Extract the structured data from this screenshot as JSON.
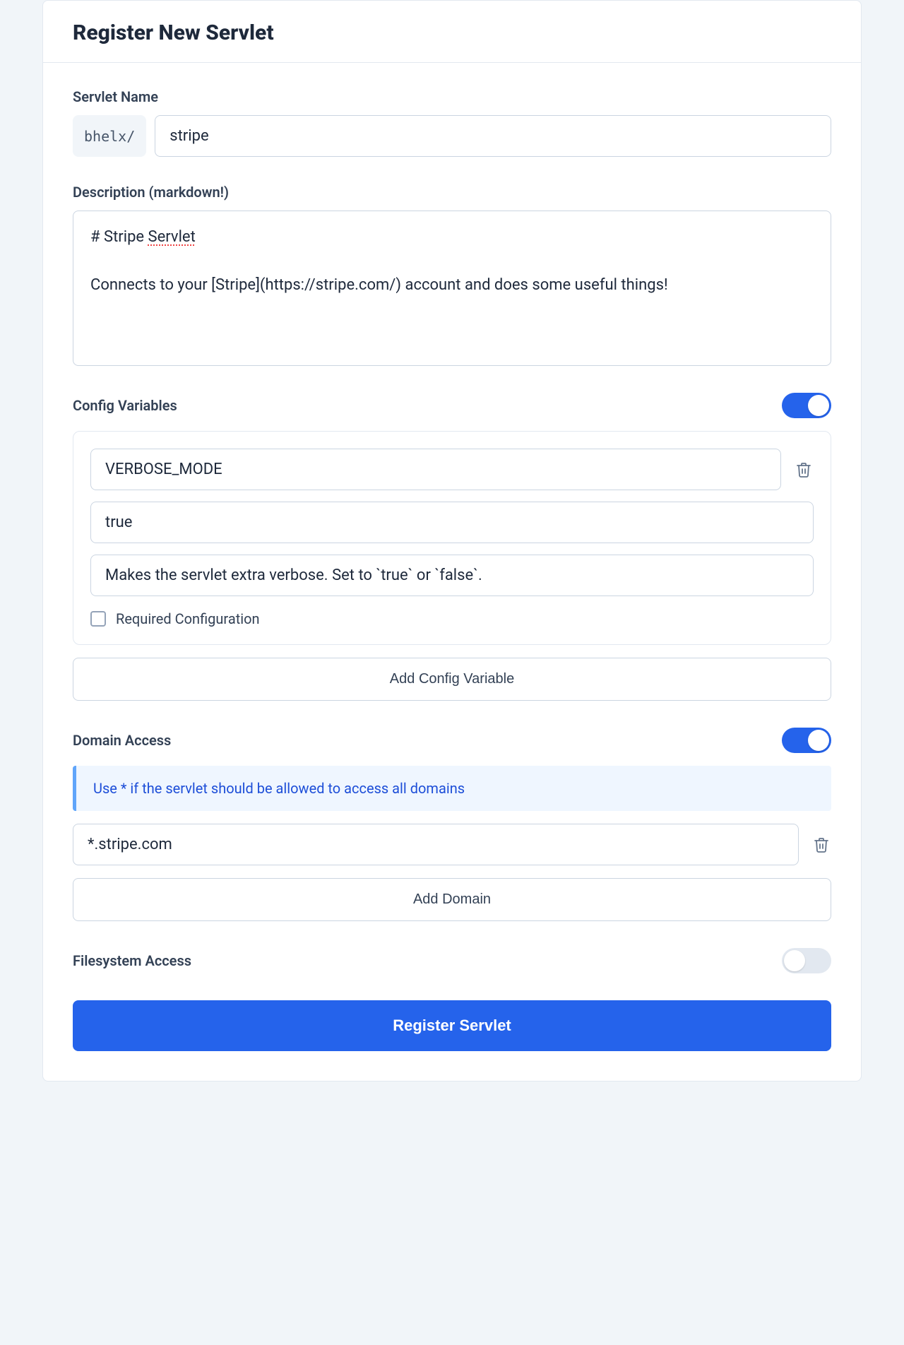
{
  "header": {
    "title": "Register New Servlet"
  },
  "servletName": {
    "label": "Servlet Name",
    "prefix": "bhelx/",
    "value": "stripe"
  },
  "description": {
    "label": "Description (markdown!)",
    "value": "# Stripe Servlet\n\nConnects to your [Stripe](https://stripe.com/) account and does some useful things!"
  },
  "configVariables": {
    "label": "Config Variables",
    "enabled": true,
    "items": [
      {
        "key": "VERBOSE_MODE",
        "defaultValue": "true",
        "helpText": "Makes the servlet extra verbose. Set to `true` or `false`.",
        "required": false
      }
    ],
    "requiredLabel": "Required Configuration",
    "addButton": "Add Config Variable"
  },
  "domainAccess": {
    "label": "Domain Access",
    "enabled": true,
    "hint": "Use * if the servlet should be allowed to access all domains",
    "items": [
      "*.stripe.com"
    ],
    "addButton": "Add Domain"
  },
  "filesystemAccess": {
    "label": "Filesystem Access",
    "enabled": false
  },
  "submit": {
    "label": "Register Servlet"
  }
}
